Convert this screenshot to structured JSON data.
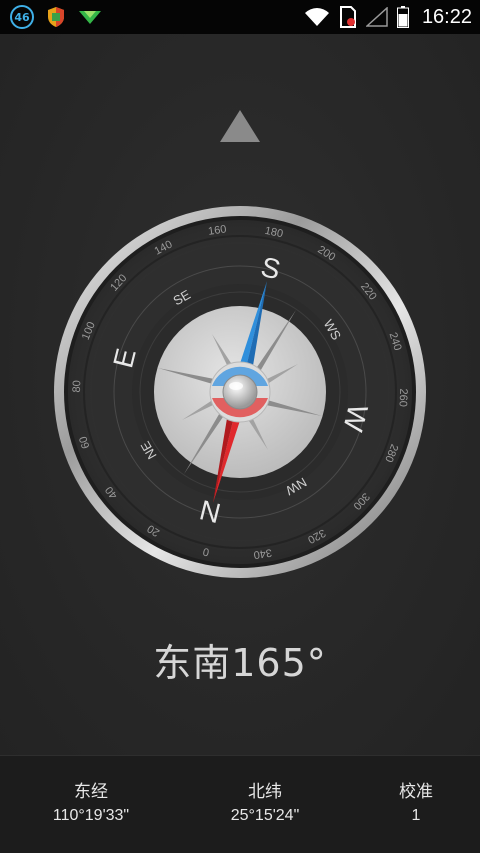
{
  "status_bar": {
    "network_badge": "46",
    "time": "16:22",
    "icons": [
      "shield-app-icon",
      "download-arrow-icon",
      "wifi-icon",
      "sim-card-icon",
      "signal-icon",
      "battery-icon"
    ]
  },
  "compass": {
    "heading_text": "东南165°",
    "heading_degrees": 165,
    "cardinals": {
      "s": "S",
      "w": "W",
      "n": "N",
      "e": "E"
    },
    "intercardinals": {
      "se": "SE",
      "ws": "WS",
      "nw": "NW",
      "ne": "NE"
    },
    "ticks": [
      "180",
      "200",
      "220",
      "240",
      "260",
      "280",
      "300",
      "320",
      "340",
      "0",
      "20",
      "40",
      "60",
      "80",
      "100",
      "120",
      "140",
      "160"
    ],
    "colors": {
      "north_needle": "#e0282c",
      "south_needle": "#2f8fdc",
      "bezel": "#bdbdbd"
    }
  },
  "info": {
    "longitude": {
      "label": "东经",
      "value": "110°19'33\""
    },
    "latitude": {
      "label": "北纬",
      "value": "25°15'24\""
    },
    "calibrate": {
      "label": "校准",
      "value": "1"
    }
  }
}
